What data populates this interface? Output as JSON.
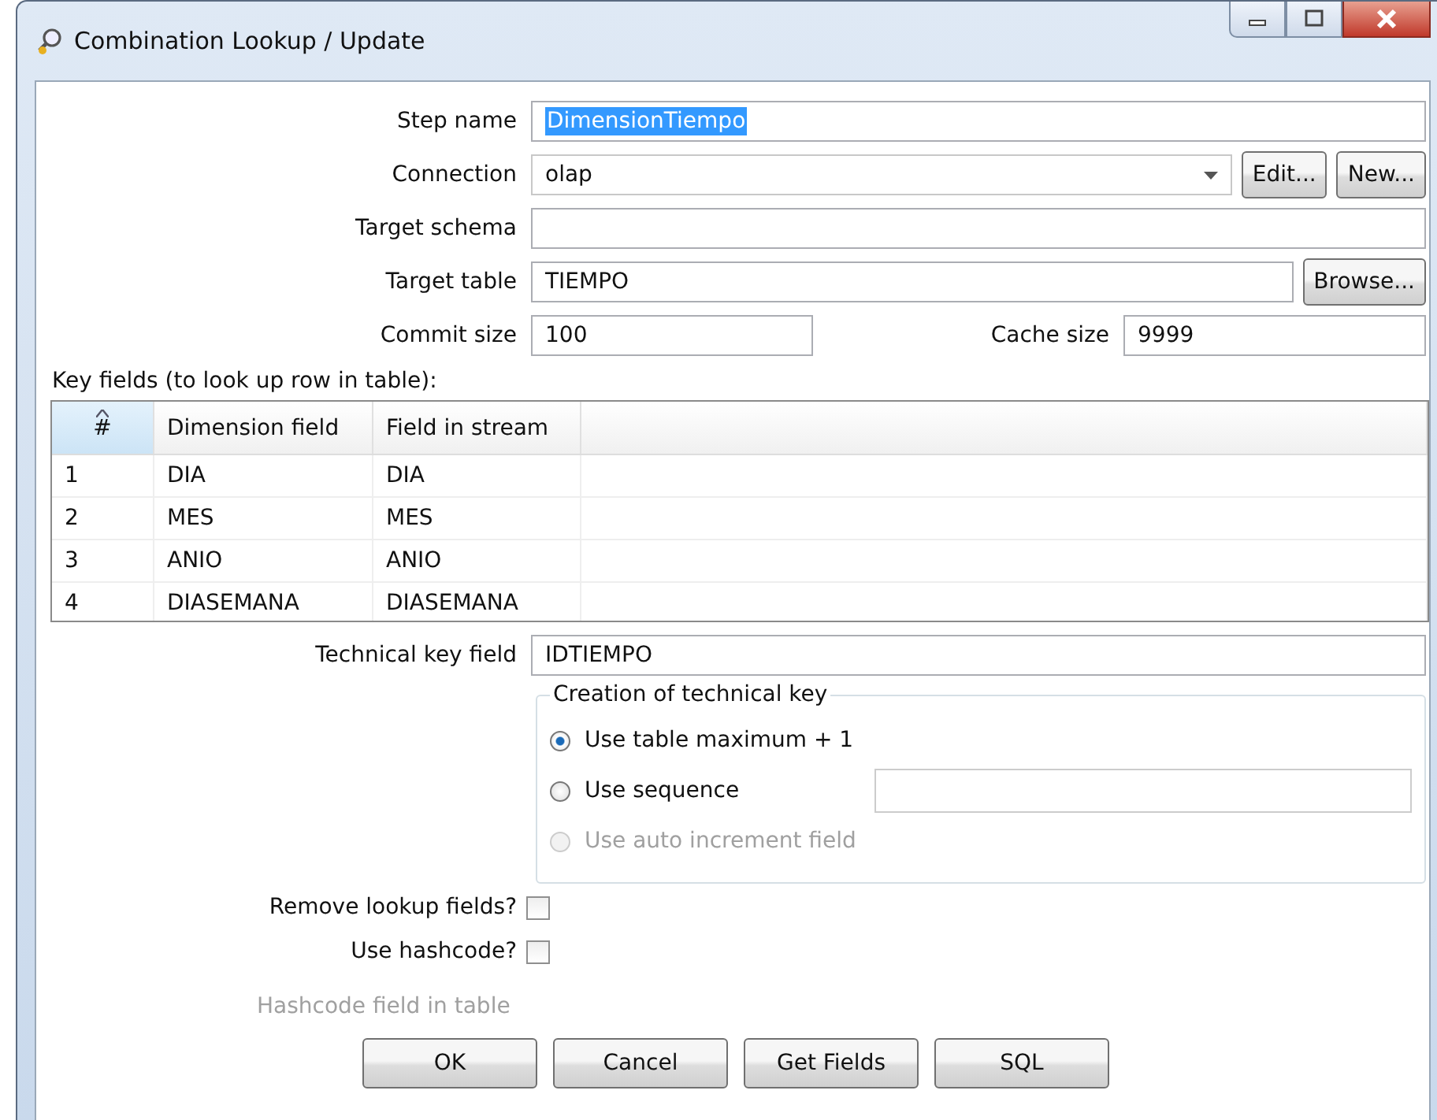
{
  "window": {
    "title": "Combination Lookup / Update"
  },
  "step_name": {
    "label": "Step name",
    "value": "DimensionTiempo",
    "selected": true
  },
  "connection": {
    "label": "Connection",
    "value": "olap",
    "buttons": [
      "Edit...",
      "New..."
    ]
  },
  "target_schema": {
    "label": "Target schema"
  },
  "target_table": {
    "label": "Target table",
    "value": "TIEMPO",
    "button": "Browse..."
  },
  "commit_size": {
    "label": "Commit size",
    "value": "100"
  },
  "cache_size": {
    "label": "Cache size",
    "value": "9999"
  },
  "key_fields": {
    "label": "Key fields (to look up row in table):",
    "columns": [
      {
        "label": "#",
        "sorted": true
      },
      {
        "label": "Dimension field",
        "sorted": false
      },
      {
        "label": "Field in stream",
        "sorted": false
      }
    ],
    "rows": [
      [
        "1",
        "DIA",
        "DIA"
      ],
      [
        "2",
        "MES",
        "MES"
      ],
      [
        "3",
        "ANIO",
        "ANIO"
      ],
      [
        "4",
        "DIASEMANA",
        "DIASEMANA"
      ]
    ]
  },
  "technical_key": {
    "label": "Technical key field",
    "value": "IDTIEMPO"
  },
  "creation": {
    "title": "Creation of technical key",
    "options": [
      {
        "label": "Use table maximum + 1",
        "selected": true,
        "disabled": false,
        "kind": "plain"
      },
      {
        "label": "Use sequence",
        "selected": false,
        "disabled": false,
        "kind": "field"
      },
      {
        "label": "Use auto increment field",
        "selected": false,
        "disabled": true,
        "kind": "plain"
      }
    ]
  },
  "checkboxes": [
    {
      "label": "Remove lookup fields?",
      "checked": false
    },
    {
      "label": "Use hashcode?",
      "checked": false
    }
  ],
  "hashcode_field": {
    "label": "Hashcode field in table",
    "disabled": true
  },
  "buttons": [
    "OK",
    "Cancel",
    "Get Fields",
    "SQL"
  ]
}
